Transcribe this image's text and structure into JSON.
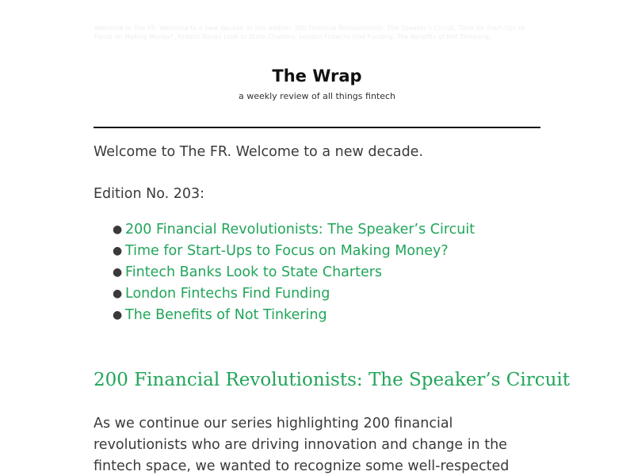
{
  "preheader": "Welcome to The FR. Welcome to a new decade. In this edition: 200 Financial Revolutionists: The Speaker’s Circuit, Time for Start-Ups to Focus on Making Money?, Fintech Banks Look to State Charters, London Fintechs Find Funding, The Benefits of Not Tinkering.",
  "masthead": {
    "title": "The Wrap",
    "tagline": "a weekly review of all things fintech"
  },
  "intro": {
    "welcome": "Welcome to The FR. Welcome to a new decade.",
    "edition": "Edition No. 203:"
  },
  "toc": {
    "items": [
      {
        "label": "200 Financial Revolutionists: The Speaker’s Circuit"
      },
      {
        "label": "Time for Start-Ups to Focus on Making Money?"
      },
      {
        "label": "Fintech Banks Look to State Charters"
      },
      {
        "label": "London Fintechs Find Funding"
      },
      {
        "label": "The Benefits of Not Tinkering"
      }
    ]
  },
  "article": {
    "heading": "200 Financial Revolutionists: The Speaker’s Circuit",
    "paragraph": "As we continue our series highlighting 200 financial revolutionists who are driving innovation and change in the fintech space, we wanted to recognize some well-respected"
  },
  "colors": {
    "link": "#21a55a",
    "body_text": "#3a3a3a",
    "rule": "#111111"
  }
}
